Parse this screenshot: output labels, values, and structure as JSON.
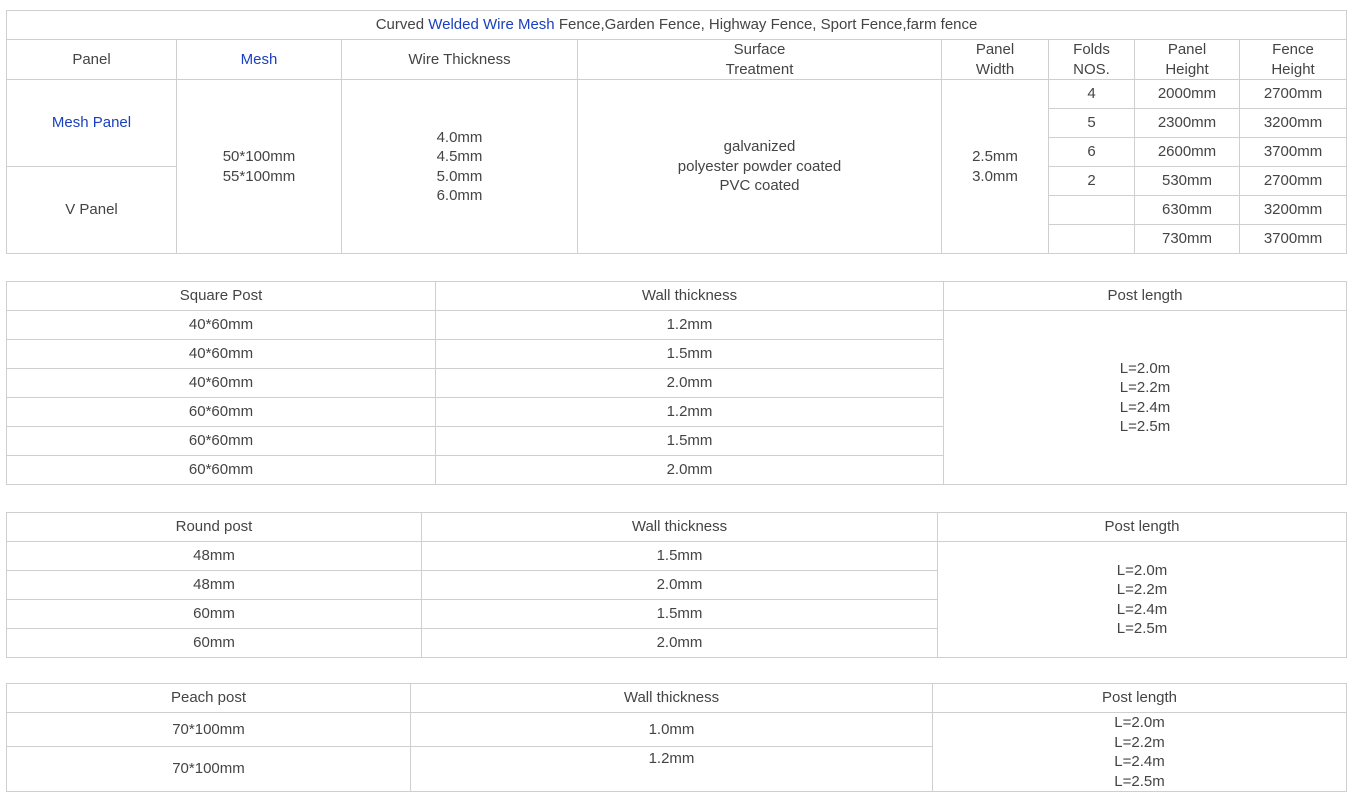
{
  "panel_table": {
    "title_parts": {
      "prefix": "Curved ",
      "link": "Welded Wire Mesh",
      "suffix": " Fence,Garden Fence, Highway Fence, Sport Fence,farm fence"
    },
    "headers": {
      "panel": "Panel",
      "mesh": "Mesh",
      "wire_thickness": "Wire Thickness",
      "surface_line1": "Surface",
      "surface_line2": "Treatment",
      "panel_width_line1": "Panel",
      "panel_width_line2": "Width",
      "folds_line1": "Folds",
      "folds_line2": "NOS.",
      "panel_height_line1": "Panel",
      "panel_height_line2": "Height",
      "fence_height_line1": "Fence",
      "fence_height_line2": "Height"
    },
    "panel_types": [
      "Mesh Panel",
      "V Panel"
    ],
    "mesh_sizes": [
      "50*100mm",
      "55*100mm"
    ],
    "wire_thicknesses": [
      "4.0mm",
      "4.5mm",
      "5.0mm",
      "6.0mm"
    ],
    "surface_treatments": [
      "galvanized",
      "polyester powder coated",
      "PVC coated"
    ],
    "panel_widths": [
      "2.5mm",
      "3.0mm"
    ],
    "rows": [
      {
        "folds": "4",
        "panel_height": "2000mm",
        "fence_height": "2700mm"
      },
      {
        "folds": "5",
        "panel_height": "2300mm",
        "fence_height": "3200mm"
      },
      {
        "folds": "6",
        "panel_height": "2600mm",
        "fence_height": "3700mm"
      },
      {
        "folds": "2",
        "panel_height": "530mm",
        "fence_height": "2700mm"
      },
      {
        "folds": "",
        "panel_height": "630mm",
        "fence_height": "3200mm"
      },
      {
        "folds": "",
        "panel_height": "730mm",
        "fence_height": "3700mm"
      }
    ]
  },
  "square_post_table": {
    "headers": [
      "Square Post",
      "Wall thickness",
      "Post length"
    ],
    "rows": [
      {
        "size": "40*60mm",
        "wall": "1.2mm"
      },
      {
        "size": "40*60mm",
        "wall": "1.5mm"
      },
      {
        "size": "40*60mm",
        "wall": "2.0mm"
      },
      {
        "size": "60*60mm",
        "wall": "1.2mm"
      },
      {
        "size": "60*60mm",
        "wall": "1.5mm"
      },
      {
        "size": "60*60mm",
        "wall": "2.0mm"
      }
    ],
    "post_lengths": [
      "L=2.0m",
      "L=2.2m",
      "L=2.4m",
      "L=2.5m"
    ]
  },
  "round_post_table": {
    "headers": [
      "Round post",
      "Wall thickness",
      "Post length"
    ],
    "rows": [
      {
        "size": "48mm",
        "wall": "1.5mm"
      },
      {
        "size": "48mm",
        "wall": "2.0mm"
      },
      {
        "size": "60mm",
        "wall": "1.5mm"
      },
      {
        "size": "60mm",
        "wall": "2.0mm"
      }
    ],
    "post_lengths": [
      "L=2.0m",
      "L=2.2m",
      "L=2.4m",
      "L=2.5m"
    ]
  },
  "peach_post_table": {
    "headers": [
      "Peach post",
      "Wall thickness",
      "Post length"
    ],
    "rows": [
      {
        "size": "70*100mm",
        "wall": "1.0mm"
      },
      {
        "size": "70*100mm",
        "wall": "1.2mm"
      }
    ],
    "post_lengths": [
      "L=2.0m",
      "L=2.2m",
      "L=2.4m",
      "L=2.5m"
    ]
  }
}
